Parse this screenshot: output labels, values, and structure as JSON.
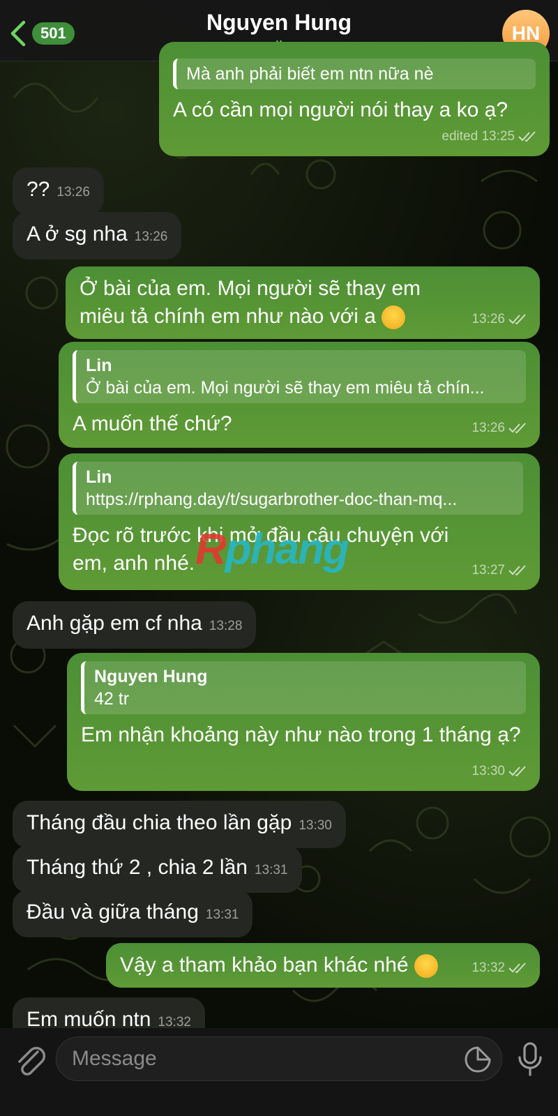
{
  "header": {
    "back_count": "501",
    "contact_name": "Nguyen Hung",
    "status": "online",
    "avatar_initials": "HN"
  },
  "messages": [
    {
      "dir": "out",
      "reply_name": "Nguyen Hung",
      "reply_text": "Mà anh phải biết em ntn nữa nè",
      "text": "A có cần mọi người nói thay a ko ạ?",
      "time": "edited 13:25"
    },
    {
      "dir": "in",
      "text": "??",
      "time": "13:26"
    },
    {
      "dir": "in",
      "text": "A ở sg nha",
      "time": "13:26"
    },
    {
      "dir": "out",
      "text": "Ở bài của em. Mọi người sẽ thay em miêu tả chính em như nào với a",
      "time": "13:26"
    },
    {
      "dir": "out",
      "reply_name": "Lin",
      "reply_text": "Ở bài của em. Mọi người sẽ thay em miêu tả chín...",
      "text": "A muốn thế chứ?",
      "time": "13:26"
    },
    {
      "dir": "out",
      "reply_name": "Lin",
      "reply_text": "https://rphang.day/t/sugarbrother-doc-than-mq...",
      "text": "Đọc rõ trước khi mở đầu câu chuyện với em, anh nhé.",
      "time": "13:27"
    },
    {
      "dir": "in",
      "text": "Anh gặp em cf nha",
      "time": "13:28"
    },
    {
      "dir": "out",
      "reply_name": "Nguyen Hung",
      "reply_text": "42 tr",
      "text": "Em nhận khoảng này như nào trong 1 tháng ạ?",
      "time": "13:30"
    },
    {
      "dir": "in",
      "text": "Tháng đầu chia theo lần gặp",
      "time": "13:30"
    },
    {
      "dir": "in",
      "text": "Tháng thứ 2 , chia 2 lần",
      "time": "13:31"
    },
    {
      "dir": "in",
      "text": "Đầu và giữa tháng",
      "time": "13:31"
    },
    {
      "dir": "out",
      "text": "Vậy a tham khảo bạn khác nhé",
      "time": "13:32"
    },
    {
      "dir": "in",
      "text": "Em muốn ntn",
      "time": "13:32"
    }
  ],
  "watermark": {
    "first": "R",
    "rest": "phang"
  },
  "composer": {
    "placeholder": "Message"
  },
  "icons": {
    "back": "chevron-left-icon",
    "attach": "paperclip-icon",
    "sticker": "sticker-icon",
    "mic": "microphone-icon",
    "read": "double-check-icon",
    "emoji": "smiling-face-icon"
  },
  "colors": {
    "accent": "#6fd462",
    "outgoing_bubble": "#4c8f35",
    "incoming_bubble": "#242722",
    "badge": "#3e8e3a",
    "avatar": "#f29a3a"
  }
}
